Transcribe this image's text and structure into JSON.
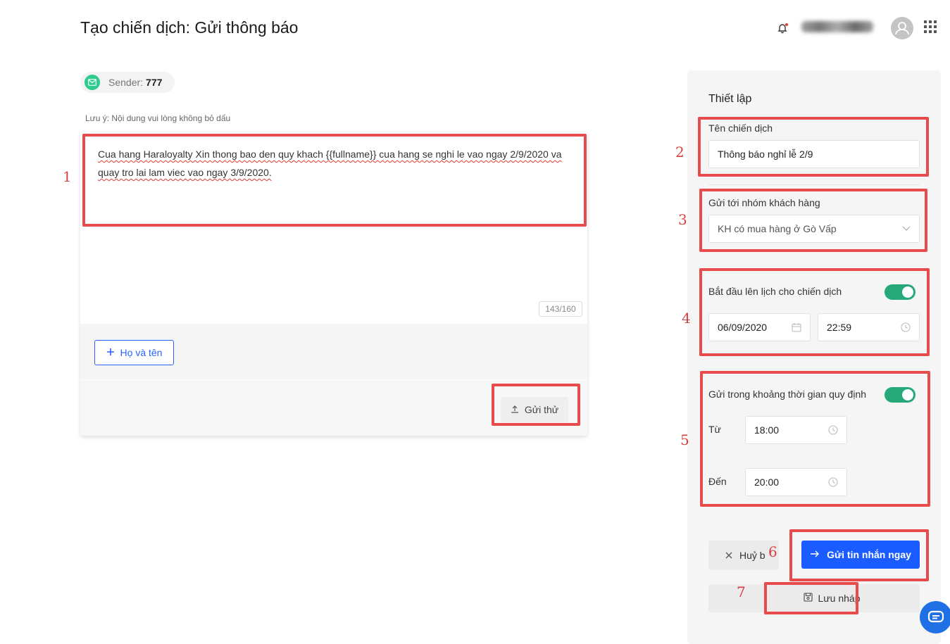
{
  "page_title": "Tạo chiến dịch: Gửi thông báo",
  "header": {
    "bell_icon": "bell-icon",
    "avatar_icon": "user-icon",
    "apps_icon": "grid-apps-icon"
  },
  "sender": {
    "label": "Sender:",
    "value": "777"
  },
  "note": "Lưu ý: Nội dung vui lòng không bỏ dấu",
  "message": {
    "text": "Cua hang Haraloyalty Xin thong bao den quy khach {{fullname}} cua hang se nghi le vao ngay 2/9/2020 va quay tro lai lam viec vao ngay 3/9/2020.",
    "counter": "143/160"
  },
  "add_field_button": "Họ và tên",
  "test_send_button": "Gửi thử",
  "settings": {
    "title": "Thiết lập",
    "campaign_name_label": "Tên chiến dịch",
    "campaign_name_value": "Thông báo nghỉ lễ 2/9",
    "group_label": "Gửi tới nhóm khách hàng",
    "group_value": "KH có mua hàng ở Gò Vấp",
    "schedule_label": "Bắt đầu lên lịch cho chiến dịch",
    "schedule_enabled": true,
    "schedule_date": "06/09/2020",
    "schedule_time": "22:59",
    "window_label": "Gửi trong khoảng thời gian quy định",
    "window_enabled": true,
    "from_label": "Từ",
    "from_value": "18:00",
    "to_label": "Đến",
    "to_value": "20:00"
  },
  "buttons": {
    "cancel": "Huỷ b",
    "send_now": "Gửi tin nhắn ngay",
    "save_draft": "Lưu nháp"
  },
  "annotations": [
    "1",
    "2",
    "3",
    "4",
    "5",
    "6",
    "7"
  ],
  "colors": {
    "primary": "#1a5cff",
    "toggle_on": "#26a878",
    "annotation": "#e84b4b"
  }
}
